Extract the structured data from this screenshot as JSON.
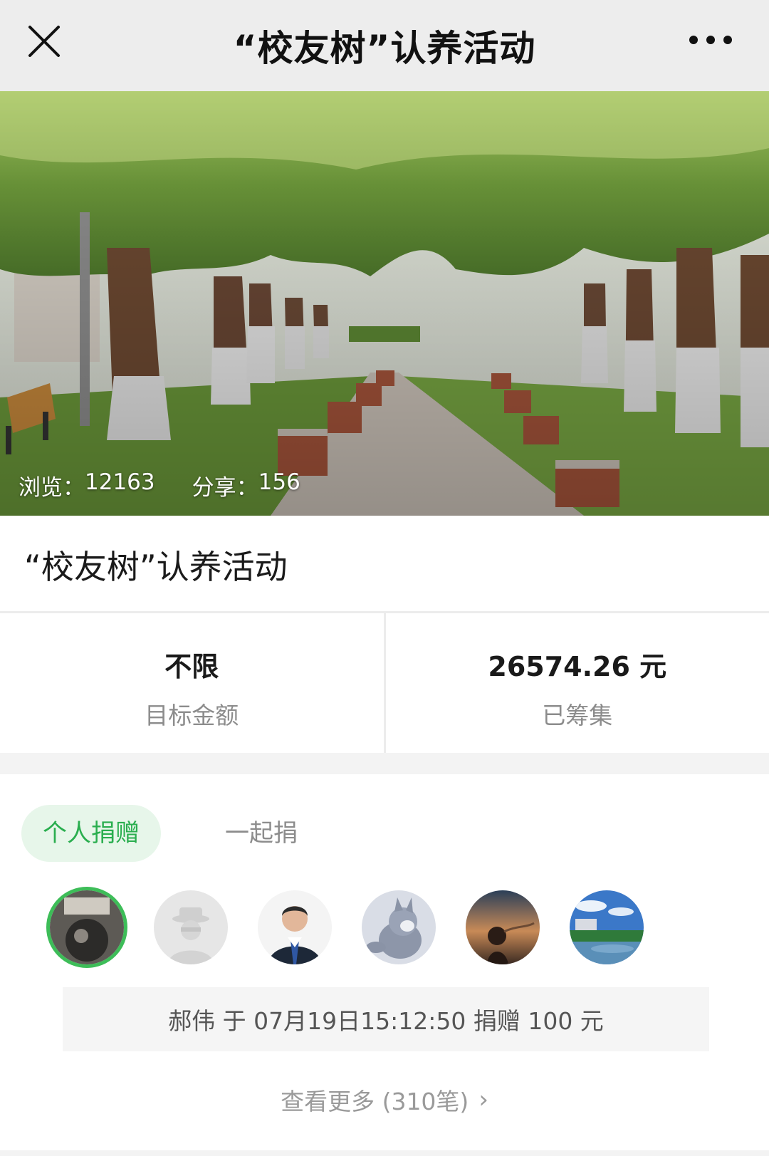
{
  "header": {
    "title": "“校友树”认养活动",
    "close_icon": "close-icon",
    "more_icon": "more-horizontal-icon"
  },
  "hero": {
    "views_label": "浏览：",
    "views_value": "12163",
    "shares_label": "分享：",
    "shares_value": "156"
  },
  "event": {
    "title": "“校友树”认养活动"
  },
  "stats": {
    "target_value": "不限",
    "target_label": "目标金额",
    "raised_value": "26574.26 元",
    "raised_label": "已筹集"
  },
  "tabs": {
    "personal": "个人捐赠",
    "together": "一起捐"
  },
  "donation": {
    "latest_text": "郝伟 于 07月19日15:12:50 捐赠 100 元"
  },
  "view_more": {
    "label": "查看更多 (310笔)",
    "chevron": "›"
  },
  "colors": {
    "accent": "#3dbd58",
    "tab_active_bg": "#e7f6ea",
    "tab_active_text": "#2aae4f",
    "nav_bg": "#ededed"
  }
}
